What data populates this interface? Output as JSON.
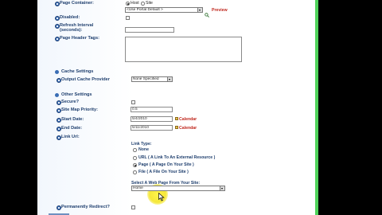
{
  "form": {
    "page_container": {
      "label": "Page Container:",
      "radio_host": "Host",
      "radio_site": "Site",
      "selected_value": "<Use Portal Default >",
      "preview_link": "Preview"
    },
    "disabled": {
      "label": "Disabled:"
    },
    "refresh_interval": {
      "label": "Refresh Interval (seconds):",
      "value": ""
    },
    "page_header_tags": {
      "label": "Page Header Tags:",
      "value": ""
    },
    "cache_settings": {
      "section_title": "Cache Settings",
      "output_cache_provider_label": "Output Cache Provider",
      "output_cache_provider_value": "None Specified"
    },
    "other_settings": {
      "section_title": "Other Settings",
      "secure_label": "Secure?",
      "site_map_priority_label": "Site Map Priority:",
      "site_map_priority_value": "0.5",
      "start_date_label": "Start Date:",
      "start_date_value": "5/4/2010",
      "end_date_label": "End Date:",
      "end_date_value": "5/11/2010",
      "calendar_link": "Calendar",
      "link_url_label": "Link Url:",
      "link_type_label": "Link Type:",
      "link_types": [
        {
          "label": "None",
          "checked": false
        },
        {
          "label": "URL ( A Link To An External Resource )",
          "checked": false
        },
        {
          "label": "Page ( A Page On Your Site )",
          "checked": true
        },
        {
          "label": "File ( A File On Your Site )",
          "checked": false
        }
      ],
      "select_page_label": "Select A Web Page From Your Site:",
      "select_page_value": "Home",
      "permanently_redirect_label": "Permanently Redirect?"
    }
  },
  "colors": {
    "label_blue": "#1f3f6e",
    "link_red": "#c0281e",
    "side_green": "#4fd35a",
    "cursor_highlight": "#f5e83a"
  }
}
